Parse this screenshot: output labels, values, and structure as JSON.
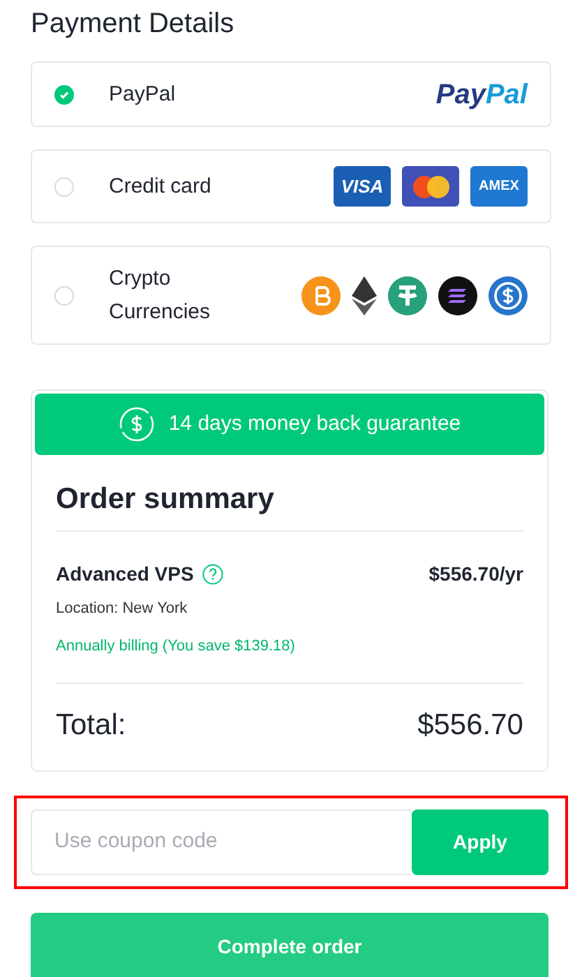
{
  "title": "Payment Details",
  "methods": [
    {
      "kind": "paypal",
      "label": "PayPal",
      "selected": true,
      "logos": [
        "PayPal"
      ]
    },
    {
      "kind": "card",
      "label": "Credit card",
      "selected": false,
      "logos": [
        {
          "kind": "visa",
          "text": "VISA"
        },
        {
          "kind": "mastercard"
        },
        {
          "kind": "amex",
          "text": "AMEX"
        }
      ]
    },
    {
      "kind": "crypto",
      "label": "Crypto Currencies",
      "selected": false
    }
  ],
  "banner": "14 days money back guarantee",
  "summary": {
    "title": "Order summary",
    "product": "Advanced VPS",
    "price": "$556.70/yr",
    "location": "Location: New York",
    "billing": "Annually billing (You save $139.18)",
    "total_label": "Total:",
    "total": "$556.70"
  },
  "coupon": {
    "placeholder": "Use coupon code",
    "button": "Apply",
    "highlighted": true
  },
  "submit": "Complete order"
}
